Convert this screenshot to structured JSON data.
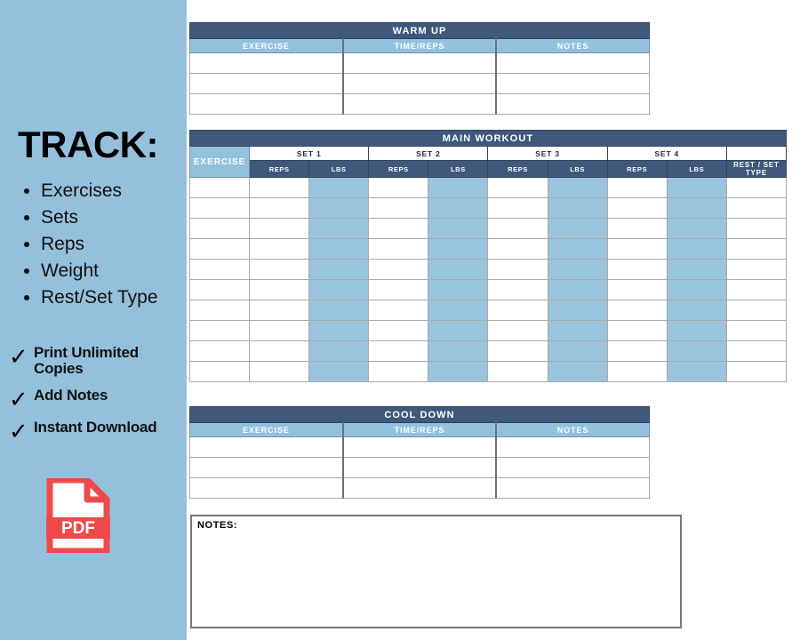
{
  "sidebar": {
    "heading": "TRACK:",
    "bullets": [
      {
        "label": "Exercises"
      },
      {
        "label": "Sets"
      },
      {
        "label": "Reps"
      },
      {
        "label": "Weight"
      },
      {
        "label": "Rest/Set Type"
      }
    ],
    "features": [
      {
        "mark": "✓",
        "label": "Print Unlimited Copies"
      },
      {
        "mark": "✓",
        "label": "Add Notes"
      },
      {
        "mark": "✓",
        "label": "Instant Download"
      }
    ],
    "pdf_icon": {
      "name": "pdf-file-icon",
      "label": "PDF"
    },
    "colors": {
      "background": "#95c0dc",
      "text": "#111111",
      "pdf_red": "#ef4a4a"
    }
  },
  "sheet": {
    "warm_up": {
      "title": "WARM UP",
      "columns": [
        "EXERCISE",
        "TIME/REPS",
        "NOTES"
      ],
      "row_count": 3
    },
    "main_workout": {
      "title": "MAIN WORKOUT",
      "exercise_column": "EXERCISE",
      "sets": [
        {
          "label": "SET 1",
          "sub": [
            "REPS",
            "LBS"
          ]
        },
        {
          "label": "SET 2",
          "sub": [
            "REPS",
            "LBS"
          ]
        },
        {
          "label": "SET 3",
          "sub": [
            "REPS",
            "LBS"
          ]
        },
        {
          "label": "SET 4",
          "sub": [
            "REPS",
            "LBS"
          ]
        }
      ],
      "rest_column": "REST / SET TYPE",
      "row_count": 10
    },
    "cool_down": {
      "title": "COOL DOWN",
      "columns": [
        "EXERCISE",
        "TIME/REPS",
        "NOTES"
      ],
      "row_count": 3
    },
    "notes": {
      "label": "NOTES:",
      "value": ""
    },
    "colors": {
      "header_dark": "#3f587c",
      "header_light": "#93c1dd",
      "lbs_fill": "#9ac3dd",
      "grid": "#a9a9a9"
    }
  }
}
